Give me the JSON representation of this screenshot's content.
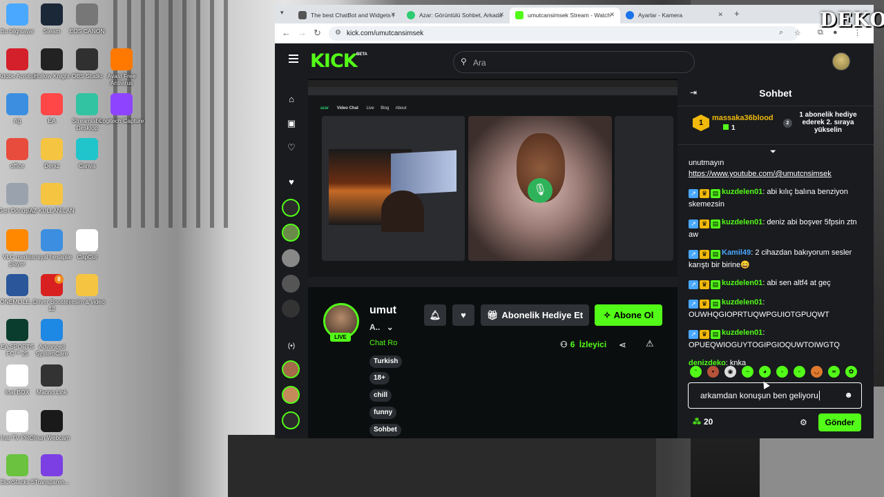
{
  "desktop": {
    "icons": [
      {
        "label": "Bu bilgisayar",
        "icon": "computer-icon",
        "color": "#4aa8ff"
      },
      {
        "label": "Steam",
        "icon": "steam-icon",
        "color": "#1b2838"
      },
      {
        "label": "EOS CANON",
        "icon": "camera-icon",
        "color": "#777777"
      },
      {
        "label": "Adobe Acrobat",
        "icon": "acrobat-icon",
        "color": "#d4202a"
      },
      {
        "label": "Hollow Knight",
        "icon": "hollow-knight-icon",
        "color": "#222222"
      },
      {
        "label": "OBS Studio",
        "icon": "obs-icon",
        "color": "#303030"
      },
      {
        "label": "Avast Free Antivirus",
        "icon": "avast-icon",
        "color": "#ff7800"
      },
      {
        "label": "Ağ",
        "icon": "network-icon",
        "color": "#3c8fe0"
      },
      {
        "label": "EA",
        "icon": "ea-icon",
        "color": "#ff4747"
      },
      {
        "label": "Streamlabs Desktop",
        "icon": "streamlabs-icon",
        "color": "#31c3a2"
      },
      {
        "label": "Logitech Capture",
        "icon": "logitech-icon",
        "color": "#8e44ff"
      },
      {
        "label": "office",
        "icon": "office-icon",
        "color": "#e84c3d"
      },
      {
        "label": "Deniz",
        "icon": "folder-icon",
        "color": "#f5c542"
      },
      {
        "label": "Canva",
        "icon": "canva-icon",
        "color": "#20c4cb"
      },
      {
        "label": "Geri Dönüşü...",
        "icon": "recycle-bin-icon",
        "color": "#9aa3ad"
      },
      {
        "label": "AZ KULLANILAN",
        "icon": "folder-icon",
        "color": "#f5c542"
      },
      {
        "label": "VLC media player",
        "icon": "vlc-icon",
        "color": "#ff8800"
      },
      {
        "label": "sosyal hesaplar",
        "icon": "globe-icon",
        "color": "#3c8fe0"
      },
      {
        "label": "CapCut",
        "icon": "capcut-icon",
        "color": "#ffffff"
      },
      {
        "label": "ÖNEMLİLE...",
        "icon": "word-icon",
        "color": "#2b579a"
      },
      {
        "label": "Driver Booster 12",
        "icon": "driver-booster-icon",
        "color": "#d92020"
      },
      {
        "label": "resim & video",
        "icon": "folder-icon",
        "color": "#f5c542"
      },
      {
        "label": "EA SPORTS FC™ 25",
        "icon": "fc25-icon",
        "color": "#0b3d2e"
      },
      {
        "label": "Advanced SystemCare",
        "icon": "systemcare-icon",
        "color": "#1e88e5"
      },
      {
        "label": "İnat BOX",
        "icon": "file-icon",
        "color": "#ffffff"
      },
      {
        "label": "Maono Link",
        "icon": "maono-icon",
        "color": "#333333"
      },
      {
        "label": "İnat TV PRO",
        "icon": "file-icon",
        "color": "#ffffff"
      },
      {
        "label": "Inun Webcam",
        "icon": "webcam-icon",
        "color": "#1a1a1a"
      },
      {
        "label": "BlueStacks 5",
        "icon": "bluestacks-icon",
        "color": "#6ac23f"
      },
      {
        "label": "Transparen...",
        "icon": "chat-bubble-icon",
        "color": "#7b3fe4"
      }
    ],
    "badge_count": "8",
    "overlay_logo": "DEKO"
  },
  "browser": {
    "tabs": [
      {
        "title": "The best ChatBot and Widgets f",
        "icon": "streamelements-icon",
        "color": "#555555"
      },
      {
        "title": "Azar: Görüntülü Sohbet, Arkada",
        "icon": "azar-icon",
        "color": "#2ecc71"
      },
      {
        "title": "umutcansimsek Stream - Watch",
        "icon": "kick-icon",
        "color": "#53fc18"
      },
      {
        "title": "Ayarlar - Kamera",
        "icon": "settings-icon",
        "color": "#1a73e8"
      }
    ],
    "url": "kick.com/umutcansimsek"
  },
  "kick": {
    "logo": "KICK",
    "logo_badge": "BETA",
    "search_placeholder": "Ara",
    "stream_inner": {
      "nav": [
        "Video Chat",
        "Live",
        "Blog",
        "About"
      ],
      "brand": "azar"
    },
    "channel": {
      "name": "umut",
      "title": "A..",
      "category": "Chat Ro",
      "live_label": "LIVE",
      "tags": [
        "Turkish",
        "18+",
        "chill",
        "funny",
        "Sohbet"
      ]
    },
    "actions": {
      "gift_sub": "Abonelik Hediye Et",
      "subscribe": "Abone Ol"
    },
    "viewers": {
      "count": "6",
      "label": "İzleyici"
    },
    "colors": {
      "accent": "#53fc18",
      "bg": "#0b0e0f",
      "panel": "#191b1f"
    }
  },
  "chat": {
    "title": "Sohbet",
    "pinned": {
      "rank": "1",
      "user": "massaka36blood",
      "gift_count": "1",
      "next_rank": "2",
      "promo": "1 abonelik hediye ederek 2. sıraya yükselin"
    },
    "messages": [
      {
        "user": "",
        "text": "unutmayın",
        "badges": false
      },
      {
        "user": "",
        "text": "https://www.youtube.com/@umutcnsimsek",
        "badges": false,
        "link": true
      },
      {
        "user": "kuzdelen01",
        "text": ": abi kılıç balına benziyon skemezsin",
        "badges": true,
        "color": "#53fc18"
      },
      {
        "user": "kuzdelen01",
        "text": ": deniz abi boşver 5fpsin ztn aw",
        "badges": true,
        "color": "#53fc18"
      },
      {
        "user": "Kamil49",
        "text": ": 2 cihazdan bakıyorum sesler karıştı bir birine😄",
        "badges": true,
        "color": "#4aa8ff"
      },
      {
        "user": "kuzdelen01",
        "text": ": abi sen altf4 at geç",
        "badges": true,
        "color": "#53fc18"
      },
      {
        "user": "kuzdelen01",
        "text": ": OUWHQGIOPRTUQWPGUIOTGPUQWT",
        "badges": true,
        "color": "#53fc18"
      },
      {
        "user": "kuzdelen01",
        "text": ": OPUEQWIOGUYTOGIPGIOQUWTOIWGTQ",
        "badges": true,
        "color": "#53fc18"
      },
      {
        "user": "denizdeko",
        "text": ": knka",
        "badges": false,
        "color": "#53fc18"
      }
    ],
    "input_value": "arkamdan konuşun ben geliyoru",
    "points": "20",
    "send_label": "Gönder"
  }
}
